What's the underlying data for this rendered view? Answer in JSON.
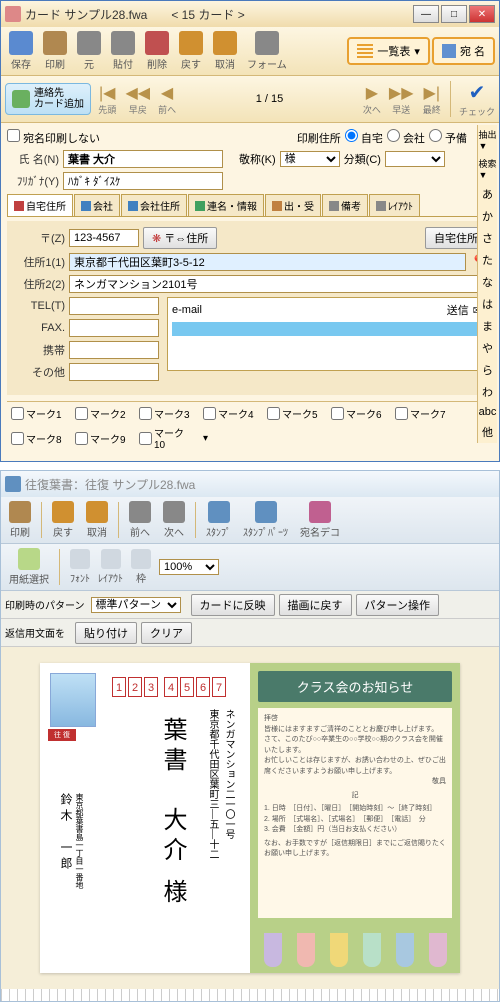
{
  "win1": {
    "title": "カード  サンプル28.fwa　　< 15 カード >",
    "toolbar": [
      {
        "label": "保存",
        "color": "#5a8ad0"
      },
      {
        "label": "印刷",
        "color": "#b08850"
      },
      {
        "label": "元",
        "color": "#888"
      },
      {
        "label": "貼付",
        "color": "#888"
      },
      {
        "label": "削除",
        "color": "#c05050"
      },
      {
        "label": "戻す",
        "color": "#d09030"
      },
      {
        "label": "取消",
        "color": "#d09030"
      },
      {
        "label": "フォーム",
        "color": "#888"
      }
    ],
    "view_list": "一覧表",
    "view_name": "宛 名",
    "contact_add": "連絡先\nカード追加",
    "nav": {
      "first": "先頭",
      "prev": "早戻",
      "back": "前へ",
      "pos": "1 / 15",
      "next": "次へ",
      "fwd": "早送",
      "last": "最終",
      "check": "チェック"
    },
    "no_print": "宛名印刷しない",
    "print_addr": "印刷住所",
    "home": "自宅",
    "office": "会社",
    "reserve": "予備",
    "extract": "抽出",
    "search": "検索",
    "name_lbl": "氏 名(N)",
    "name": "葉書 大介",
    "title_lbl": "敬称(K)",
    "title_val": "様",
    "cat_lbl": "分類(C)",
    "furi_lbl": "ﾌﾘｶﾞﾅ(Y)",
    "furi": "ﾊｶﾞｷ ﾀﾞｲｽｹ",
    "tabs": [
      "自宅住所",
      "会社",
      "会社住所",
      "連名・情報",
      "出・受",
      "備考",
      "ﾚｲｱｳﾄ"
    ],
    "zip_lbl": "〒(Z)",
    "zip": "123-4567",
    "zip_btn": "〒⇔住所",
    "home_addr_btn": "自宅住所",
    "addr1_lbl": "住所1(1)",
    "addr1": "東京都千代田区葉町3-5-12",
    "addr2_lbl": "住所2(2)",
    "addr2": "ネンガマンション2101号",
    "tel_lbl": "TEL(T)",
    "fax_lbl": "FAX.",
    "mobile_lbl": "携帯",
    "other_lbl": "その他",
    "email_lbl": "e-mail",
    "send_lbl": "送信",
    "marks": [
      "マーク1",
      "マーク2",
      "マーク3",
      "マーク4",
      "マーク5",
      "マーク6",
      "マーク7",
      "マーク8",
      "マーク9",
      "マーク10"
    ],
    "kana": [
      "あ",
      "か",
      "さ",
      "た",
      "な",
      "は",
      "ま",
      "や",
      "ら",
      "わ",
      "abc",
      "他"
    ]
  },
  "win2": {
    "title": "往復葉書：往復  サンプル28.fwa",
    "tb": [
      "印刷",
      "戻す",
      "取消",
      "前へ",
      "次へ",
      "ｽﾀﾝﾌﾟ",
      "ｽﾀﾝﾌﾟﾊﾟｰﾂ",
      "宛名デコ"
    ],
    "tb2_sel": "用紙選択",
    "tb2": [
      "ﾌｫﾝﾄ",
      "ﾚｲｱｳﾄ",
      "枠"
    ],
    "zoom": "100%",
    "tb3_lbl": "印刷時のパターン",
    "tb3_sel": "標準パターン",
    "tb3_btns": [
      "カードに反映",
      "描画に戻す",
      "パターン操作"
    ],
    "tb4_lbl": "返信用文面を",
    "tb4_btns": [
      "貼り付け",
      "クリア"
    ]
  },
  "postcard": {
    "zip": [
      "1",
      "2",
      "3",
      "4",
      "5",
      "6",
      "7"
    ],
    "stamp_label": "往 復",
    "recipient": "葉書　大介 様",
    "addr_line1": "東京都千代田区葉町三―五―十二",
    "addr_line2": "ネンガマンション二一〇一号",
    "sender_addr": "東京都葉書島一丁目一番地",
    "sender_name": "鈴木　一郎",
    "banner": "クラス会のお知らせ",
    "body_head": "拝啓",
    "body1": "皆様にはますますご清祥のこととお慶び申し上げます。",
    "body2": "さて、このたび○○卒業生の○○学校○○期のクラス会を開催いたします。",
    "body3": "お忙しいことは存じますが、お誘い合わせの上、ぜひご出席くださいますようお願い申し上げます。",
    "body_foot": "敬具",
    "ki": "記",
    "items": [
      "1. 日時　［日付］、［曜日］　［開始時刻］～［終了時刻］",
      "2. 場所　［式場名］、［式場名］　［郵便］　［電話］　分",
      "3. 会費　［金額］円（当日お支払ください）"
    ],
    "note": "なお、お手数ですが［返信期限日］までにご返信賜りたくお願い申し上げます。"
  }
}
